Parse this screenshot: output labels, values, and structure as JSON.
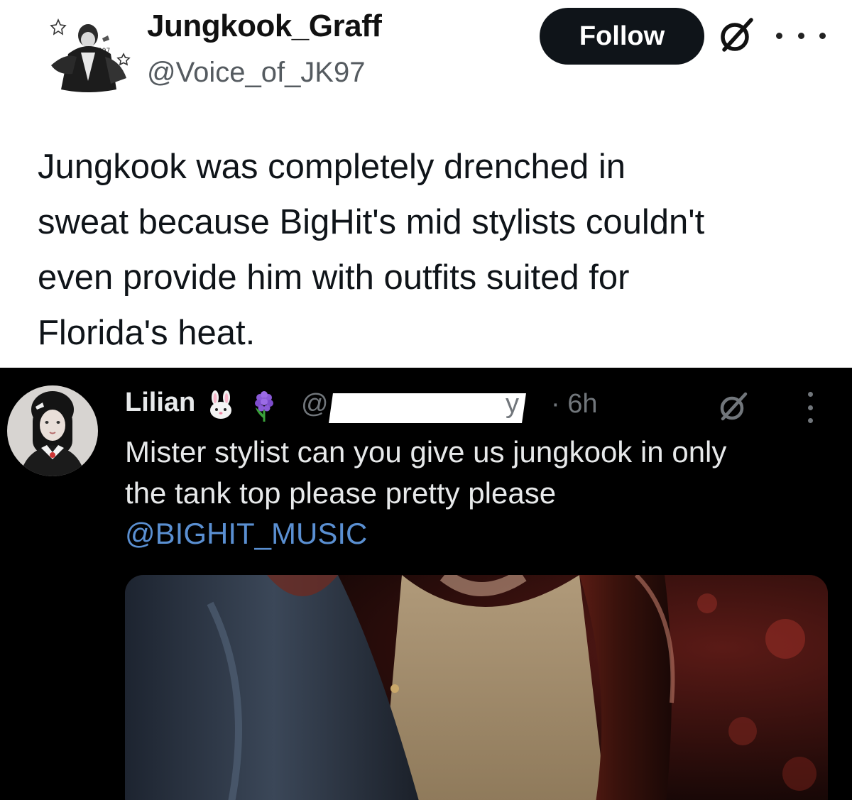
{
  "original_tweet": {
    "author": {
      "display_name": "Jungkook_Graff",
      "handle": "@Voice_of_JK97",
      "avatar_icon": "profile-photo-icon"
    },
    "follow_label": "Follow",
    "text": "Jungkook was completely drenched in\nsweat because BigHit's mid stylists couldn't\neven provide him with outfits  suited for\nFlorida's heat.",
    "icons": [
      "grok-icon",
      "more-horizontal-icon"
    ]
  },
  "reply": {
    "author": {
      "display_name": "Lilian",
      "handle_visible_start": "@",
      "handle_visible_end": "y",
      "time": "· 6h",
      "emojis": [
        "rabbit-face-emoji",
        "hyacinth-emoji"
      ]
    },
    "text": "Mister stylist can you give us jungkook in only\nthe tank top please pretty please",
    "mention": "@BIGHIT_MUSIC",
    "icons": [
      "grok-icon",
      "more-vertical-icon"
    ],
    "media": "photo-tank-top-leather-jacket"
  },
  "colors": {
    "light_bg": "#ffffff",
    "dark_bg": "#000000",
    "text_dark": "#0f1419",
    "text_light": "#e7e9ea",
    "secondary": "#71767b",
    "mention": "#5a8fd1",
    "follow_bg": "#0f1419"
  }
}
